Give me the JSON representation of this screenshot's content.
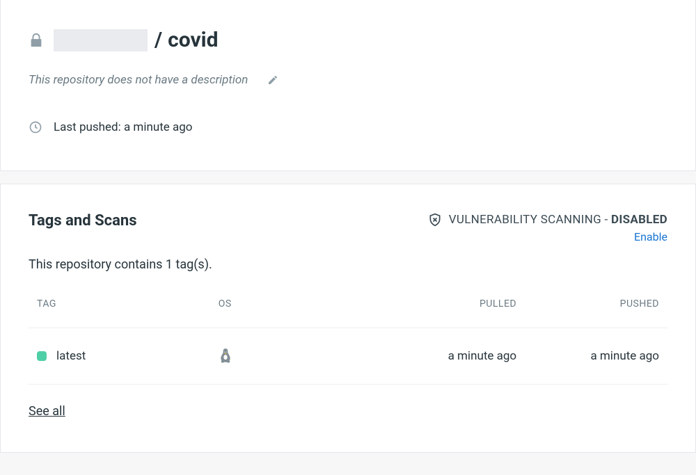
{
  "header": {
    "slash": "/",
    "repo_name": "covid",
    "description_placeholder": "This repository does not have a description",
    "last_pushed_label": "Last pushed: a minute ago"
  },
  "tags": {
    "heading": "Tags and Scans",
    "vuln_label": "VULNERABILITY SCANNING - ",
    "vuln_status": "DISABLED",
    "enable_label": "Enable",
    "count_text": "This repository contains 1 tag(s).",
    "columns": {
      "tag": "TAG",
      "os": "OS",
      "pulled": "PULLED",
      "pushed": "PUSHED"
    },
    "rows": [
      {
        "name": "latest",
        "os": "linux",
        "pulled": "a minute ago",
        "pushed": "a minute ago"
      }
    ],
    "see_all": "See all"
  }
}
